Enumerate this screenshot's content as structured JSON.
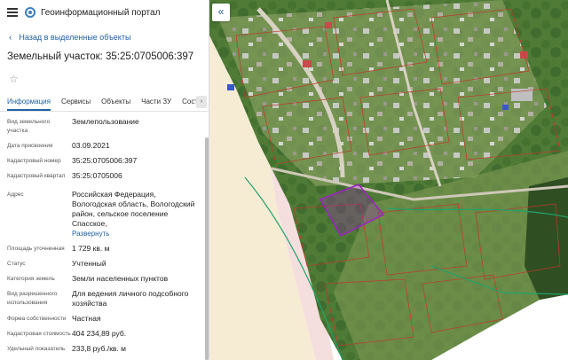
{
  "app": {
    "title": "Геоинформационный портал"
  },
  "nav": {
    "back_label": "Назад в выделенные объекты"
  },
  "parcel": {
    "title": "Земельный участок: 35:25:0705006:397"
  },
  "tabs": [
    {
      "label": "Информация",
      "active": true
    },
    {
      "label": "Сервисы",
      "active": false
    },
    {
      "label": "Объекты",
      "active": false
    },
    {
      "label": "Части ЗУ",
      "active": false
    },
    {
      "label": "Состав",
      "active": false
    }
  ],
  "attributes": [
    {
      "label": "Вид земельного участка",
      "value": "Землепользование"
    },
    {
      "label": "Дата присвоения",
      "value": "03.09.2021"
    },
    {
      "label": "Кадастровый номер",
      "value": "35:25:0705006:397"
    },
    {
      "label": "Кадастровый квартал",
      "value": "35:25:0705006"
    },
    {
      "label": "Адрес",
      "value": "Российская Федерация, Вологодская область, Вологодский район, сельское поселение Спасское,",
      "link": "Развернуть"
    },
    {
      "label": "Площадь уточненная",
      "value": "1 729 кв. м"
    },
    {
      "label": "Статус",
      "value": "Учтенный"
    },
    {
      "label": "Категория земель",
      "value": "Земли населенных пунктов"
    },
    {
      "label": "Вид разрешенного использования",
      "value": "Для ведения личного подсобного хозяйства"
    },
    {
      "label": "Форма собственности",
      "value": "Частная"
    },
    {
      "label": "Кадастровая стоимость",
      "value": "404 234,89 руб."
    },
    {
      "label": "Удельный показатель",
      "value": "233,8 руб./кв. м"
    }
  ],
  "icons": {
    "menu": "hamburger-icon",
    "logo": "portal-logo-icon",
    "back": "chevron-left-icon",
    "favorite": "star-icon",
    "tabs_next": "chevron-right-icon",
    "collapse": "double-chevron-left-icon"
  },
  "glyphs": {
    "star": "☆",
    "back": "‹",
    "next": "›",
    "collapse": "«"
  },
  "colors": {
    "accent": "#2262a6",
    "parcel_highlight": "#a020c8",
    "parcel_boundaries": "#c0392b",
    "zone_lines": "#1fa26b"
  }
}
